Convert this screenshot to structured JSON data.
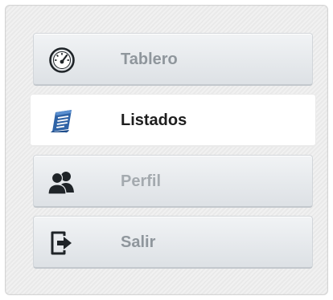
{
  "menu": {
    "items": [
      {
        "label": "Tablero",
        "icon": "speedometer-icon",
        "active": false
      },
      {
        "label": "Listados",
        "icon": "list-document-icon",
        "active": true
      },
      {
        "label": "Perfil",
        "icon": "users-icon",
        "active": false
      },
      {
        "label": "Salir",
        "icon": "logout-icon",
        "active": false
      }
    ]
  },
  "colors": {
    "icon_dark": "#1f2428",
    "icon_active_blue": "#2f63a6",
    "label_default": "#8f969c",
    "label_active": "#1e1e1e"
  }
}
